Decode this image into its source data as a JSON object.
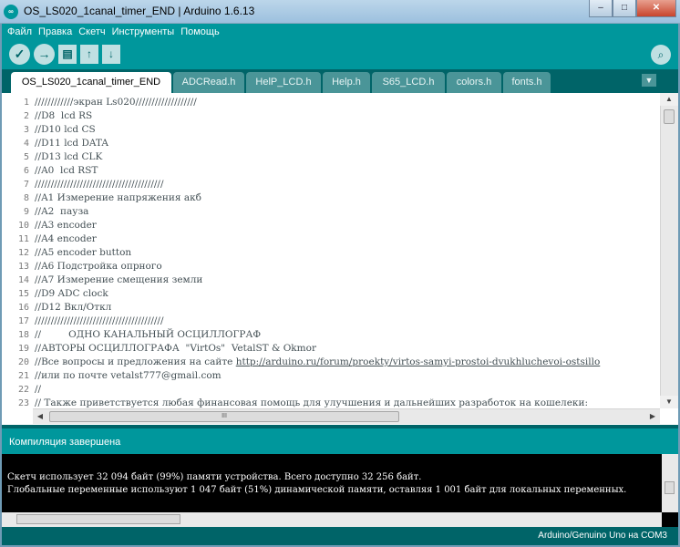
{
  "window": {
    "title": "OS_LS020_1canal_timer_END | Arduino 1.6.13",
    "minimize": "–",
    "maximize": "□",
    "close": "✕"
  },
  "menu": [
    "Файл",
    "Правка",
    "Скетч",
    "Инструменты",
    "Помощь"
  ],
  "toolbar": {
    "verify_glyph": "✓",
    "upload_glyph": "→",
    "new_glyph": "▤",
    "open_glyph": "↑",
    "save_glyph": "↓",
    "serial_glyph": "⌕"
  },
  "tabs": [
    "OS_LS020_1canal_timer_END",
    "ADCRead.h",
    "HelP_LCD.h",
    "Help.h",
    "S65_LCD.h",
    "colors.h",
    "fonts.h"
  ],
  "tab_menu_glyph": "▼",
  "editor": {
    "line_numbers": [
      "1",
      "2",
      "3",
      "4",
      "5",
      "6",
      "7",
      "8",
      "9",
      "10",
      "11",
      "12",
      "13",
      "14",
      "15",
      "16",
      "17",
      "18",
      "19",
      "20",
      "21",
      "22",
      "23"
    ],
    "lines": [
      "////////////экран Ls020///////////////////",
      "//D8  lcd RS",
      "//D10 lcd CS",
      "//D11 lcd DATA",
      "//D13 lcd CLK",
      "//A0  lcd RST",
      "////////////////////////////////////////",
      "//A1 Измерение напряжения акб",
      "//A2  пауза",
      "//A3 encoder",
      "//A4 encoder",
      "//A5 encoder button",
      "//A6 Подстройка опрного",
      "//A7 Измерение смещения земли",
      "//D9 ADC clock",
      "//D12 Вкл/Откл",
      "////////////////////////////////////////",
      "//         ОДНО КАНАЛЬНЫЙ ОСЦИЛЛОГРАФ",
      "//АВТОРЫ ОСЦИЛЛОГРАФА  \"VirtOs\"  VetalST & Okmor",
      "//Все вопросы и предложения на сайте ",
      "//или по почте vetalst777@gmail.com",
      "//",
      "// Также приветствуется любая финансовая помощь для улучшения и дальнейших разработок на кошелеки:"
    ],
    "link": "http://arduino.ru/forum/proekty/virtos-samyi-prostoi-dvukhluchevoi-ostsillo",
    "scroll_up": "▲",
    "scroll_down": "▼",
    "scroll_left": "◀",
    "scroll_right": "▶",
    "hthumb_grip": "III"
  },
  "status": {
    "message": "Компиляция завершена"
  },
  "console": {
    "lines": [
      "Скетч использует 32 094 байт (99%) памяти устройства. Всего доступно 32 256 байт.",
      "Глобальные переменные используют 1 047 байт (51%) динамической памяти, оставляя 1 001 байт для локальных переменных."
    ]
  },
  "footer": {
    "board": "Arduino/Genuino Uno на COM3"
  },
  "colors": {
    "teal": "#00979c",
    "dark_teal": "#006468",
    "console_bg": "#000000"
  }
}
